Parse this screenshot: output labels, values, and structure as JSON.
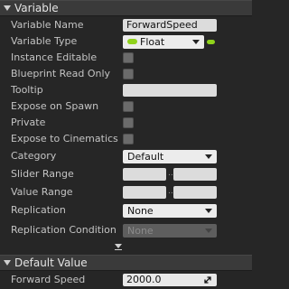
{
  "variable_section": {
    "title": "Variable",
    "rows": {
      "variable_name": {
        "label": "Variable Name",
        "value": "ForwardSpeed"
      },
      "variable_type": {
        "label": "Variable Type",
        "value": "Float"
      },
      "instance_editable": {
        "label": "Instance Editable"
      },
      "blueprint_read_only": {
        "label": "Blueprint Read Only"
      },
      "tooltip": {
        "label": "Tooltip",
        "value": ""
      },
      "expose_on_spawn": {
        "label": "Expose on Spawn"
      },
      "private": {
        "label": "Private"
      },
      "expose_to_cinematics": {
        "label": "Expose to Cinematics"
      },
      "category": {
        "label": "Category",
        "value": "Default"
      },
      "slider_range": {
        "label": "Slider Range",
        "separator": ".."
      },
      "value_range": {
        "label": "Value Range",
        "separator": ".."
      },
      "replication": {
        "label": "Replication",
        "value": "None"
      },
      "replication_condition": {
        "label": "Replication Condition",
        "value": "None"
      }
    }
  },
  "default_value_section": {
    "title": "Default Value",
    "rows": {
      "forward_speed": {
        "label": "Forward Speed",
        "value": "2000.0"
      }
    }
  },
  "icons": {
    "section_expand": "triangle-down-icon",
    "advanced_expand": "chevron-down-icon",
    "type_pin": "float-pin-icon",
    "resize": "resize-arrows-icon"
  },
  "colors": {
    "float_pin": "#8fd21b",
    "background": "#262626",
    "header": "#3a3a3a"
  }
}
